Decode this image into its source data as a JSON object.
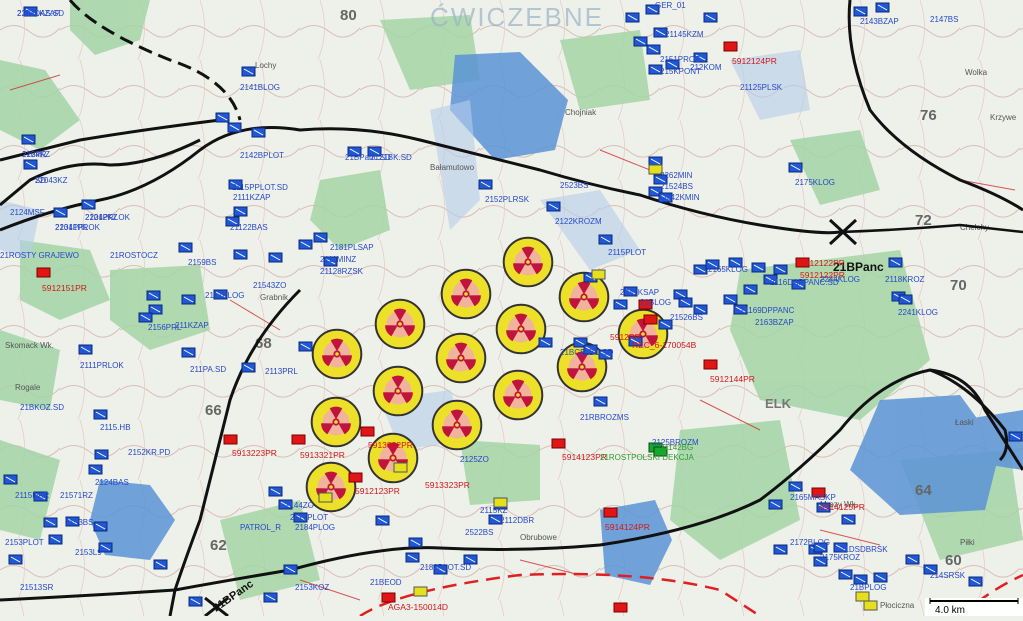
{
  "map": {
    "title_watermark": "ĆWICZEBNE",
    "grid_numbers": [
      "80",
      "76",
      "72",
      "70",
      "68",
      "66",
      "64",
      "62",
      "60"
    ],
    "place_names": [
      "Lochy",
      "Chojniak",
      "Bałamutowo",
      "Grabnik",
      "Skomack Wk.",
      "Rogale",
      "ELK",
      "Chełchy",
      "Krzywe",
      "Wolka",
      "Łaski",
      "Mrozy Wk.",
      "Piłki",
      "Obrubowe",
      "Płocicznа"
    ],
    "scale_label": "4.0 km",
    "boundary_labels": [
      "21BPanc",
      "21BPanc"
    ],
    "colors": {
      "friendly": "#1f57d6",
      "hostile": "#e01616",
      "neutral": "#e4e11c",
      "unknown": "#15a82b",
      "chemical_zone": "#ece128",
      "label_blue": "#2649c7",
      "label_red": "#d01818",
      "water": "#5b93d6",
      "forest": "#9dd2a0"
    },
    "chemical_hazard_icon": "radiation-hazard-icon",
    "blue_labels": [
      "22041KZAP",
      "2204KZ",
      "22043KZ",
      "22042KZ",
      "22041PR",
      "2141BLOG",
      "2142BPLOT",
      "21BPanc.SD",
      "2121BK.SD",
      "2115PPLOT.SD",
      "2111KZAP",
      "21122BAS",
      "2181PLSAP",
      "2111MINZ",
      "21128RZSK",
      "2159BS",
      "2117BLOG",
      "21543ZO",
      "2156PRL",
      "211KZAP",
      "2111PRLOK",
      "211PA.SD",
      "2113PRL",
      "2115.HB",
      "2152KR.PD",
      "2124BAS",
      "2115DAR",
      "21571RZ",
      "2153BS",
      "2153L9",
      "21513SR",
      "2153PLOT",
      "2153KOZ",
      "21BEOD",
      "2183PLOT.SD",
      "2115KZ",
      "2112DBR",
      "2125ZO",
      "2522BS",
      "2523BS",
      "2152PLRSK",
      "2122KROZM",
      "2115PLOT",
      "2262MIN",
      "21524BS",
      "Q242KMIN",
      "2175KLOG",
      "2165KLOG",
      "2116DAPPANC.SD",
      "21169DPPANC",
      "2163BZAP",
      "2118KROZ",
      "2241KLOG",
      "2244KLOG",
      "2241KSAP",
      "21BLOG",
      "21526BS",
      "21RBROZMS",
      "2125BROZM",
      "21125PLSK",
      "GER_01",
      "21145KZM",
      "2151PROZ",
      "215KPONT",
      "212KOM",
      "2143BZAP",
      "2147BS",
      "2117PLOT",
      "2144ZO",
      "PATROL_R",
      "2184PLOG",
      "2165MASKP",
      "2172BLOG",
      "2175KROZ",
      "21BPLOG",
      "214SRSK",
      "21DSDBRSK",
      "21ROSTOCZ",
      "21ROSTY GRAJEWO",
      "21BCS",
      "21BC.SD",
      "21BKOZ.SD",
      "2124MSF",
      "2112DAS.SD",
      "212PR",
      "SD",
      "2121PRLOK",
      "2131PRLOK"
    ],
    "red_labels": [
      "5912151PR",
      "5912124PR",
      "5912122PR",
      "5912144PR",
      "5913223PR",
      "5913321PR",
      "5912123PR",
      "5913322PR",
      "5913323PR",
      "5914123PR",
      "5914124PR",
      "5914125PR",
      "5912122PR",
      "5912PR",
      "REC_6-170054B",
      "AGA3-150014D"
    ],
    "green_labels": [
      "21142BG",
      "21ROSTPOLSKI DEKCJA"
    ],
    "special_labels": [
      "21BPanc"
    ]
  }
}
